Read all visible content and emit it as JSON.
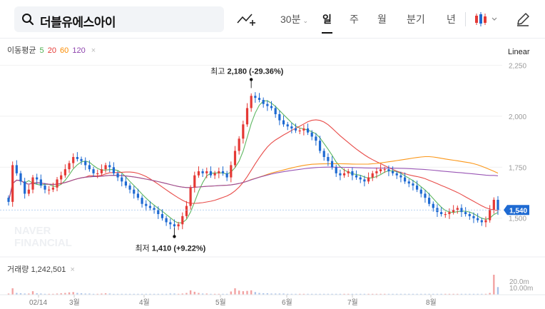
{
  "search": {
    "stock_name": "더블유에스아이"
  },
  "tabs": [
    {
      "id": "30m",
      "label": "30분"
    },
    {
      "id": "day",
      "label": "일"
    },
    {
      "id": "week",
      "label": "주"
    },
    {
      "id": "month",
      "label": "월"
    },
    {
      "id": "quarter",
      "label": "분기"
    },
    {
      "id": "year",
      "label": "년"
    }
  ],
  "active_tab": "day",
  "ma_legend": {
    "label": "이동평균",
    "periods": [
      "5",
      "20",
      "60",
      "120"
    ],
    "colors": [
      "#4caf50",
      "#e53935",
      "#fb8c00",
      "#8e44ad"
    ]
  },
  "scale": {
    "label": "Linear"
  },
  "volume_legend": {
    "label": "거래량",
    "value": "1,242,501"
  },
  "watermark": {
    "line1": "NAVER",
    "line2": "FINANCIAL"
  },
  "colors": {
    "up": "#e53935",
    "down": "#1e6ad2",
    "last_price_bg": "#1e6ad2"
  },
  "chart_data": {
    "type": "candlestick",
    "price_axis": {
      "ticks": [
        1500,
        1750,
        2000,
        2250
      ],
      "labels": [
        "1,500",
        "1,750",
        "2,000",
        "2,250"
      ],
      "range": [
        1380,
        2290
      ]
    },
    "volume_axis": {
      "labels": [
        "20.0m",
        "10.00m"
      ]
    },
    "x_labels": [
      "02/14",
      "3월",
      "4월",
      "5월",
      "6월",
      "7월",
      "8월"
    ],
    "last_price": 1540,
    "last_price_label": "1,540",
    "high_annotation": {
      "label": "최고",
      "value": "2,180",
      "change": "(-29.36%)",
      "price": 2180
    },
    "low_annotation": {
      "label": "최저",
      "value": "1,410",
      "change": "(+9.22%)",
      "price": 1410
    },
    "close": [
      1580,
      1760,
      1720,
      1680,
      1620,
      1640,
      1700,
      1690,
      1660,
      1640,
      1640,
      1650,
      1690,
      1710,
      1740,
      1770,
      1800,
      1790,
      1780,
      1760,
      1740,
      1720,
      1720,
      1740,
      1760,
      1750,
      1720,
      1700,
      1680,
      1660,
      1640,
      1620,
      1600,
      1570,
      1560,
      1550,
      1540,
      1520,
      1500,
      1480,
      1470,
      1460,
      1470,
      1510,
      1560,
      1650,
      1710,
      1730,
      1720,
      1730,
      1710,
      1720,
      1730,
      1720,
      1700,
      1760,
      1830,
      1890,
      1960,
      2040,
      2100,
      2090,
      2080,
      2060,
      2050,
      2040,
      2010,
      1980,
      1960,
      1950,
      1940,
      1930,
      1930,
      1940,
      1920,
      1900,
      1880,
      1830,
      1800,
      1780,
      1750,
      1720,
      1710,
      1720,
      1730,
      1710,
      1700,
      1690,
      1680,
      1700,
      1720,
      1730,
      1740,
      1740,
      1730,
      1720,
      1710,
      1700,
      1680,
      1670,
      1660,
      1640,
      1620,
      1600,
      1570,
      1550,
      1530,
      1520,
      1520,
      1530,
      1540,
      1550,
      1530,
      1520,
      1510,
      1500,
      1490,
      1480,
      1490,
      1540,
      1590,
      1540
    ],
    "volume": [
      0.4,
      2.2,
      0.6,
      0.5,
      0.4,
      0.4,
      1.2,
      0.5,
      0.4,
      0.3,
      0.3,
      0.3,
      0.4,
      0.5,
      0.6,
      0.8,
      0.9,
      0.6,
      0.5,
      0.4,
      0.4,
      0.3,
      0.3,
      0.4,
      0.5,
      0.4,
      0.3,
      0.3,
      0.3,
      0.3,
      0.3,
      0.3,
      0.3,
      0.3,
      0.3,
      0.3,
      0.3,
      0.3,
      0.3,
      0.3,
      0.4,
      0.4,
      0.3,
      0.4,
      0.6,
      1.5,
      1.0,
      0.6,
      0.4,
      0.4,
      0.3,
      0.3,
      0.3,
      0.3,
      0.3,
      1.1,
      2.2,
      1.4,
      1.2,
      1.3,
      1.5,
      0.9,
      0.6,
      0.5,
      0.5,
      0.4,
      0.4,
      0.4,
      0.4,
      0.3,
      0.3,
      0.3,
      0.3,
      0.3,
      0.3,
      0.3,
      0.3,
      0.3,
      0.3,
      0.3,
      0.3,
      0.3,
      0.3,
      0.3,
      0.3,
      0.3,
      0.3,
      0.3,
      0.3,
      0.3,
      0.3,
      0.3,
      0.3,
      0.3,
      0.3,
      0.3,
      0.3,
      0.3,
      0.3,
      0.3,
      0.3,
      0.3,
      0.3,
      0.3,
      0.3,
      0.3,
      0.3,
      0.3,
      0.3,
      0.3,
      0.3,
      0.3,
      0.3,
      0.3,
      0.3,
      0.3,
      0.3,
      0.3,
      0.3,
      0.6,
      6.8,
      2.6
    ]
  }
}
